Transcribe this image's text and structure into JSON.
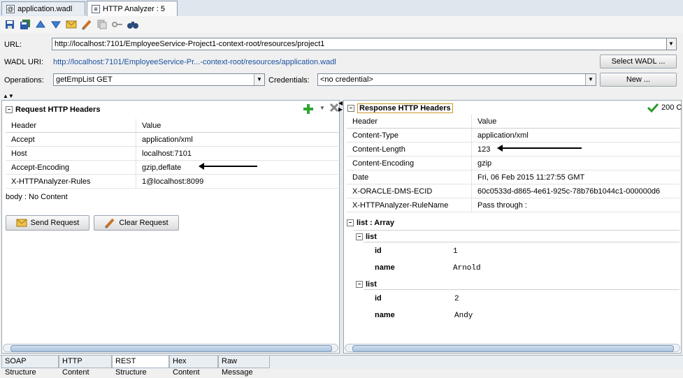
{
  "tabs": [
    {
      "label": "application.wadl",
      "icon": "at-icon"
    },
    {
      "label": "HTTP Analyzer : 5",
      "icon": "document-icon"
    }
  ],
  "toolbar": [
    "save-icon",
    "save-all-icon",
    "move-up-icon",
    "move-down-icon",
    "send-icon",
    "clear-icon",
    "copy-icon",
    "key-icon",
    "binoculars-icon"
  ],
  "form": {
    "url_label": "URL:",
    "url_value": "http://localhost:7101/EmployeeService-Project1-context-root/resources/project1",
    "wadl_label": "WADL URI:",
    "wadl_value": "http://localhost:7101/EmployeeService-Pr...-context-root/resources/application.wadl",
    "select_wadl": "Select WADL ...",
    "operations_label": "Operations:",
    "operations_value": "getEmpList GET",
    "credentials_label": "Credentials:",
    "credentials_value": "<no credential>",
    "new_button": "New ..."
  },
  "request": {
    "title": "Request HTTP Headers",
    "col_header": "Header",
    "col_value": "Value",
    "rows": [
      {
        "header": "Accept",
        "value": "application/xml"
      },
      {
        "header": "Host",
        "value": "localhost:7101"
      },
      {
        "header": "Accept-Encoding",
        "value": "gzip,deflate"
      },
      {
        "header": "X-HTTPAnalyzer-Rules",
        "value": "1@localhost:8099"
      }
    ],
    "body": "body : No Content",
    "send_button": "Send Request",
    "clear_button": "Clear Request"
  },
  "response": {
    "title": "Response HTTP Headers",
    "status": "200 C",
    "col_header": "Header",
    "col_value": "Value",
    "rows": [
      {
        "header": "Content-Type",
        "value": "application/xml"
      },
      {
        "header": "Content-Length",
        "value": "123"
      },
      {
        "header": "Content-Encoding",
        "value": "gzip"
      },
      {
        "header": "Date",
        "value": "Fri, 06 Feb 2015 11:27:55 GMT"
      },
      {
        "header": "X-ORACLE-DMS-ECID",
        "value": "60c0533d-d865-4e61-925c-78b76b1044c1-000000d6"
      },
      {
        "header": "X-HTTPAnalyzer-RuleName",
        "value": "Pass through :"
      }
    ],
    "array_title": "list : Array",
    "lists": [
      {
        "title": "list",
        "id_label": "id",
        "id_value": "1",
        "name_label": "name",
        "name_value": "Arnold"
      },
      {
        "title": "list",
        "id_label": "id",
        "id_value": "2",
        "name_label": "name",
        "name_value": "Andy"
      }
    ]
  },
  "bottom_tabs": [
    "SOAP Structure",
    "HTTP Content",
    "REST Structure",
    "Hex Content",
    "Raw Message"
  ],
  "active_bottom_tab": "REST Structure"
}
